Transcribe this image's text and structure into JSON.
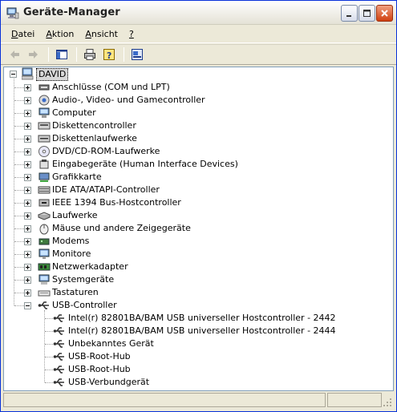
{
  "window": {
    "title": "Geräte-Manager"
  },
  "menu": [
    {
      "label": "Datei",
      "u": "D",
      "rest": "atei"
    },
    {
      "label": "Aktion",
      "u": "A",
      "rest": "ktion"
    },
    {
      "label": "Ansicht",
      "u": "A",
      "rest": "nsicht"
    },
    {
      "label": "?",
      "u": "?",
      "rest": ""
    }
  ],
  "toolbar": {
    "buttons": [
      "back-icon",
      "forward-icon",
      "show-hide-tree-icon",
      "print-icon",
      "help-icon",
      "properties-icon"
    ]
  },
  "tree": {
    "root": "DAVID",
    "categories": [
      {
        "label": "Anschlüsse (COM und LPT)",
        "icon": "port-icon"
      },
      {
        "label": "Audio-, Video- und Gamecontroller",
        "icon": "audio-icon"
      },
      {
        "label": "Computer",
        "icon": "computer-icon"
      },
      {
        "label": "Diskettencontroller",
        "icon": "floppy-controller-icon"
      },
      {
        "label": "Diskettenlaufwerke",
        "icon": "floppy-drive-icon"
      },
      {
        "label": "DVD/CD-ROM-Laufwerke",
        "icon": "cdrom-icon"
      },
      {
        "label": "Eingabegeräte (Human Interface Devices)",
        "icon": "hid-icon"
      },
      {
        "label": "Grafikkarte",
        "icon": "display-adapter-icon"
      },
      {
        "label": "IDE ATA/ATAPI-Controller",
        "icon": "ide-icon"
      },
      {
        "label": "IEEE 1394 Bus-Hostcontroller",
        "icon": "firewire-icon"
      },
      {
        "label": "Laufwerke",
        "icon": "disk-drive-icon"
      },
      {
        "label": "Mäuse und andere Zeigegeräte",
        "icon": "mouse-icon"
      },
      {
        "label": "Modems",
        "icon": "modem-icon"
      },
      {
        "label": "Monitore",
        "icon": "monitor-icon"
      },
      {
        "label": "Netzwerkadapter",
        "icon": "network-adapter-icon"
      },
      {
        "label": "Systemgeräte",
        "icon": "system-device-icon"
      },
      {
        "label": "Tastaturen",
        "icon": "keyboard-icon"
      },
      {
        "label": "USB-Controller",
        "icon": "usb-icon",
        "expanded": true
      }
    ],
    "usb_children": [
      "Intel(r) 82801BA/BAM USB universeller Hostcontroller - 2442",
      "Intel(r) 82801BA/BAM USB universeller Hostcontroller - 2444",
      "Unbekanntes Gerät",
      "USB-Root-Hub",
      "USB-Root-Hub",
      "USB-Verbundgerät"
    ]
  },
  "colors": {
    "title_bar": "#f4f3ee",
    "close_button": "#d04010",
    "selection": "#d8d8d8"
  }
}
